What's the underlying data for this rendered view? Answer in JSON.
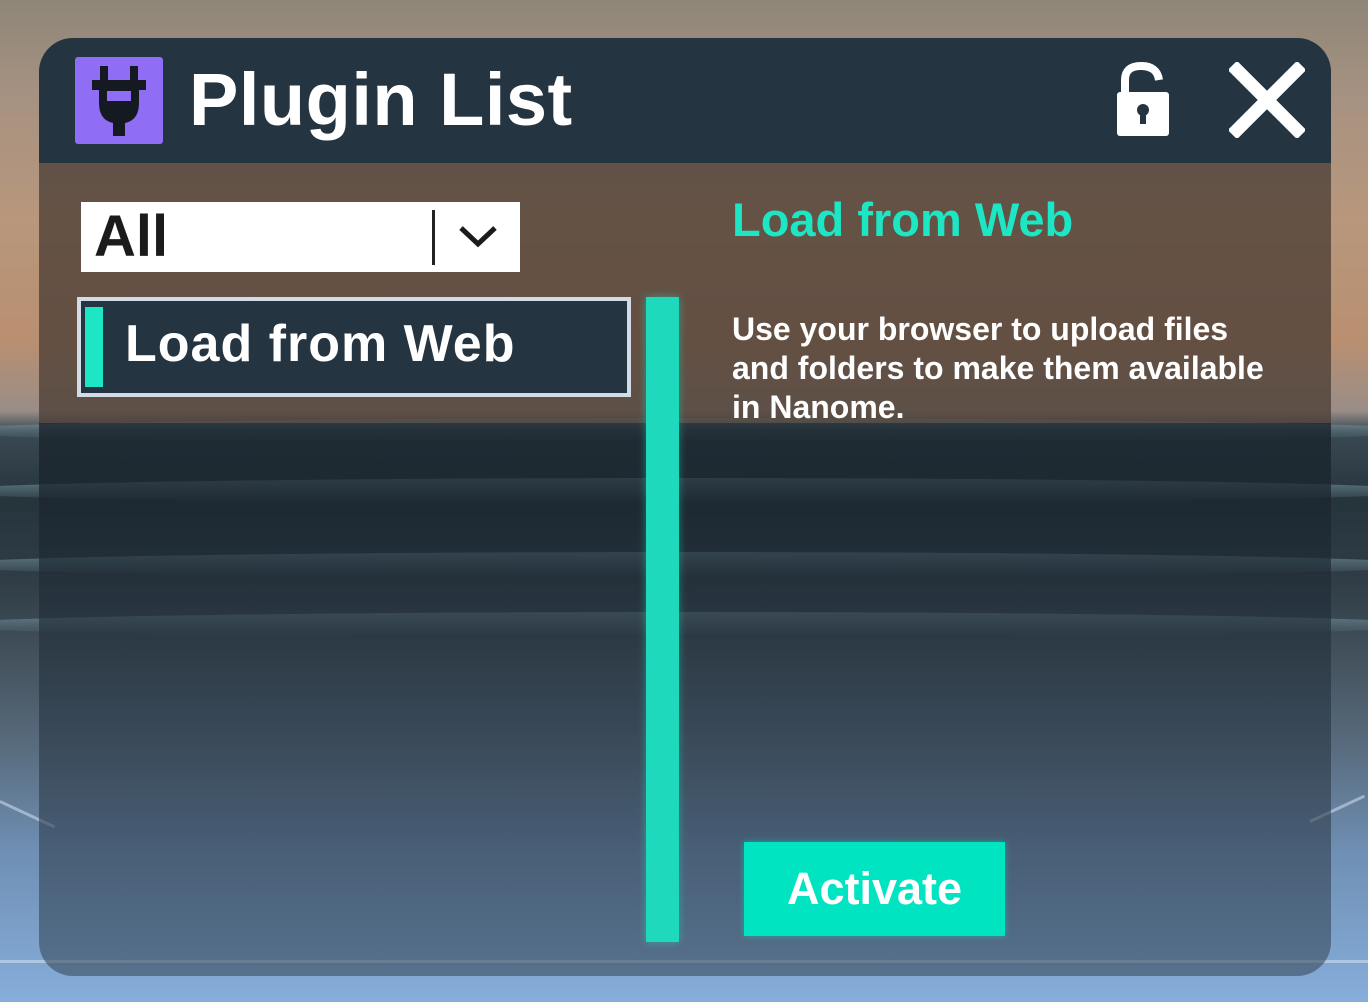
{
  "window": {
    "title": "Plugin List",
    "icons": {
      "app": "plug-icon",
      "lock": "unlocked-padlock-icon",
      "close": "close-icon"
    }
  },
  "filter": {
    "selected": "All",
    "icon": "chevron-down-icon"
  },
  "plugins": [
    {
      "label": "Load from Web",
      "selected": true
    }
  ],
  "detail": {
    "title": "Load from Web",
    "description": "Use your browser to upload files and folders to make them available in Nanome.",
    "activate_label": "Activate"
  },
  "colors": {
    "accent": "#1de6c4",
    "button": "#00e4c2",
    "titlebar": "#243441",
    "app_icon_bg": "#8f6df5"
  }
}
